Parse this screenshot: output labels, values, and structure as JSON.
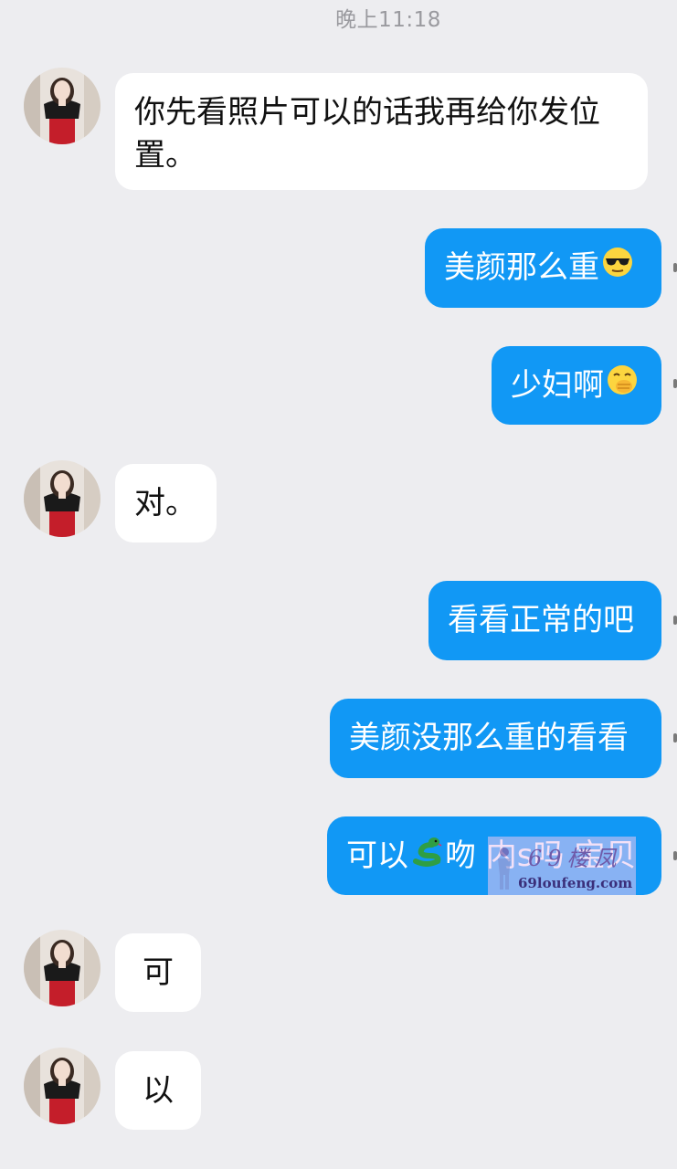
{
  "timestamp": "晚上11:18",
  "colors": {
    "background": "#ededf0",
    "incoming_bubble": "#ffffff",
    "outgoing_bubble": "#1198f5"
  },
  "messages": [
    {
      "side": "in",
      "text": "你先看照片可以的话我再给你发位置。",
      "avatar": "contact-avatar"
    },
    {
      "side": "out",
      "text": "美颜那么重",
      "emoji": "sunglasses-face-emoji"
    },
    {
      "side": "out",
      "text": "少妇啊",
      "emoji": "hand-over-mouth-face-emoji"
    },
    {
      "side": "in",
      "text": "对。",
      "avatar": "contact-avatar"
    },
    {
      "side": "out",
      "text": "看看正常的吧"
    },
    {
      "side": "out",
      "text": "美颜没那么重的看看"
    },
    {
      "side": "out",
      "text_before": "可以",
      "emoji": "snake-emoji",
      "text_after": "吻 内s吗 宝贝"
    },
    {
      "side": "in",
      "text": "可",
      "avatar": "contact-avatar"
    },
    {
      "side": "in",
      "text": "以",
      "avatar": "contact-avatar"
    }
  ],
  "watermark": {
    "logo": "69楼凤",
    "site": "69loufeng.com"
  }
}
